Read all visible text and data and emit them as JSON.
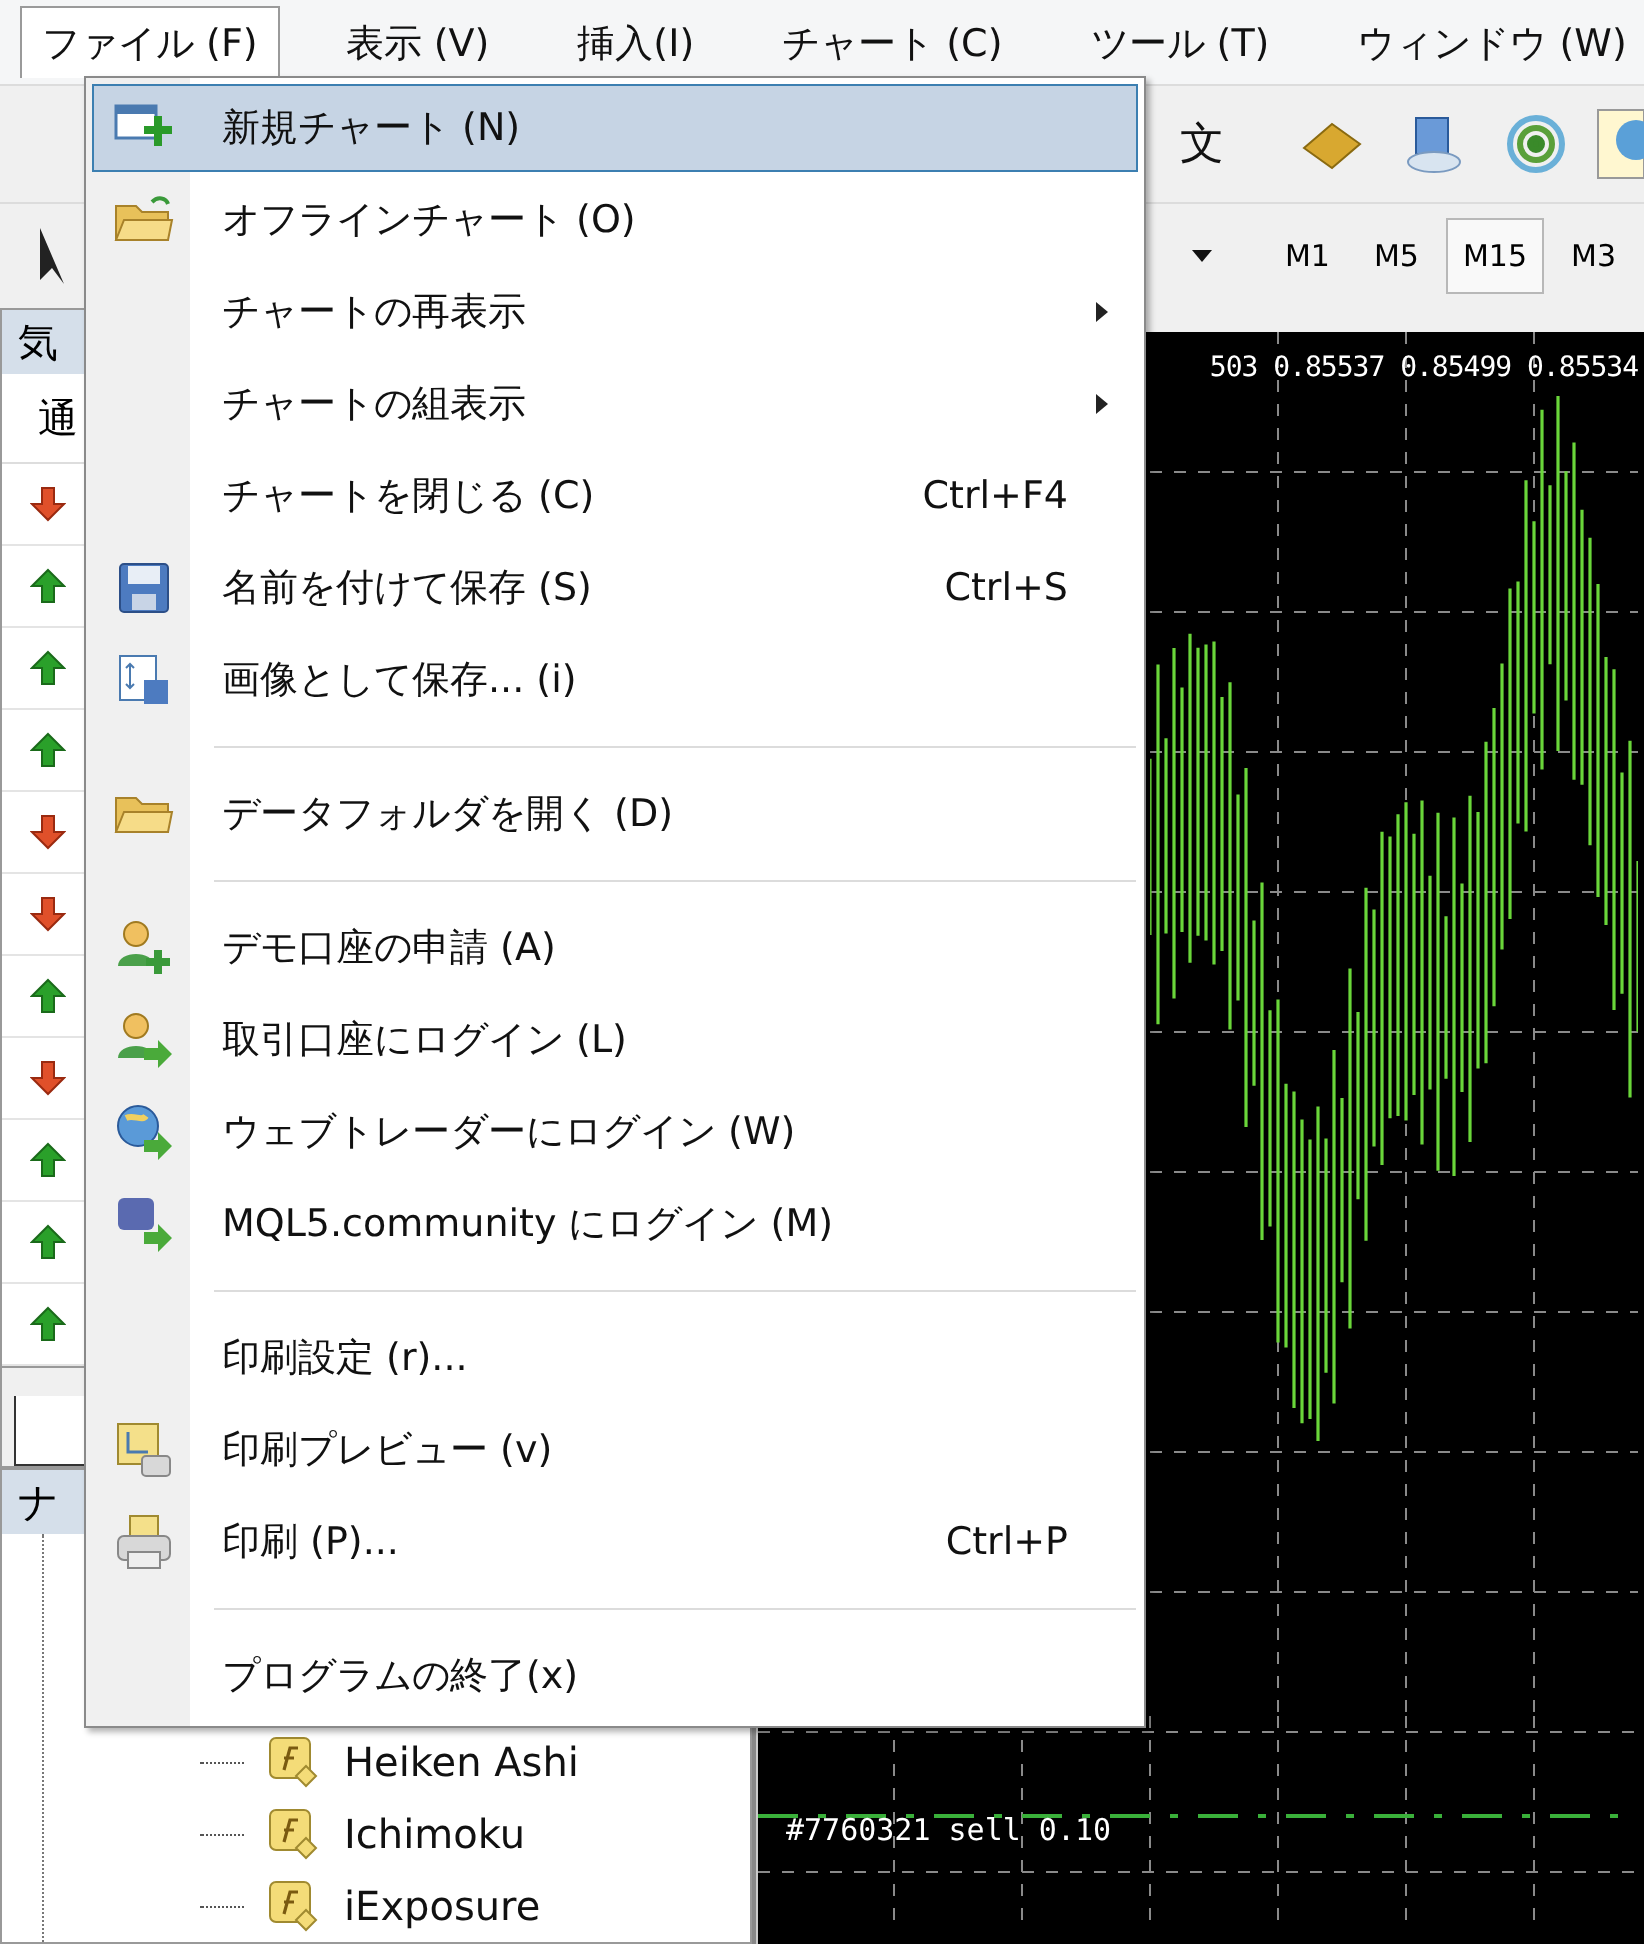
{
  "menubar": [
    {
      "label": "ファイル (F)",
      "selected": true
    },
    {
      "label": "表示 (V)",
      "selected": false
    },
    {
      "label": "挿入(I)",
      "selected": false
    },
    {
      "label": "チャート (C)",
      "selected": false
    },
    {
      "label": "ツール (T)",
      "selected": false
    },
    {
      "label": "ウィンドウ (W)",
      "selected": false
    }
  ],
  "toolbar": {
    "order_label": "文"
  },
  "timeframes": [
    {
      "label": "M1",
      "selected": false
    },
    {
      "label": "M5",
      "selected": false
    },
    {
      "label": "M15",
      "selected": true
    },
    {
      "label": "M3",
      "selected": false
    }
  ],
  "market_watch": {
    "title": "気",
    "column": "通",
    "rows": [
      {
        "rising": false
      },
      {
        "rising": true
      },
      {
        "rising": true
      },
      {
        "rising": true
      },
      {
        "rising": false
      },
      {
        "rising": false
      },
      {
        "rising": true
      },
      {
        "rising": false
      },
      {
        "rising": true
      },
      {
        "rising": true
      },
      {
        "rising": true
      }
    ]
  },
  "navigator": {
    "title": "ナ",
    "items": [
      "Heiken Ashi",
      "Ichimoku",
      "iExposure"
    ]
  },
  "chart": {
    "price_text": "503 0.85537 0.85499 0.85534",
    "order_label": "#7760321 sell 0.10"
  },
  "file_menu": [
    {
      "kind": "item",
      "label": "新規チャート (N)",
      "selected": true,
      "submenu": false
    },
    {
      "kind": "item",
      "label": "オフラインチャート (O)",
      "selected": false,
      "submenu": false
    },
    {
      "kind": "item",
      "label": "チャートの再表示",
      "selected": false,
      "submenu": true
    },
    {
      "kind": "item",
      "label": "チャートの組表示",
      "selected": false,
      "submenu": true
    },
    {
      "kind": "item",
      "label": "チャートを閉じる (C)",
      "shortcut": "Ctrl+F4",
      "selected": false,
      "submenu": false
    },
    {
      "kind": "item",
      "label": "名前を付けて保存 (S)",
      "shortcut": "Ctrl+S",
      "selected": false,
      "submenu": false
    },
    {
      "kind": "item",
      "label": "画像として保存... (i)",
      "selected": false,
      "submenu": false
    },
    {
      "kind": "separator"
    },
    {
      "kind": "item",
      "label": "データフォルダを開く (D)",
      "selected": false,
      "submenu": false
    },
    {
      "kind": "separator"
    },
    {
      "kind": "item",
      "label": "デモ口座の申請 (A)",
      "selected": false,
      "submenu": false
    },
    {
      "kind": "item",
      "label": "取引口座にログイン (L)",
      "selected": false,
      "submenu": false
    },
    {
      "kind": "item",
      "label": "ウェブトレーダーにログイン (W)",
      "selected": false,
      "submenu": false
    },
    {
      "kind": "item",
      "label": "MQL5.community にログイン (M)",
      "selected": false,
      "submenu": false
    },
    {
      "kind": "separator"
    },
    {
      "kind": "item",
      "label": "印刷設定 (r)...",
      "selected": false,
      "submenu": false
    },
    {
      "kind": "item",
      "label": "印刷プレビュー (v)",
      "selected": false,
      "submenu": false
    },
    {
      "kind": "item",
      "label": "印刷 (P)...",
      "shortcut": "Ctrl+P",
      "selected": false,
      "submenu": false
    },
    {
      "kind": "separator"
    },
    {
      "kind": "item",
      "label": "プログラムの終了(x)",
      "selected": false,
      "submenu": false
    }
  ]
}
